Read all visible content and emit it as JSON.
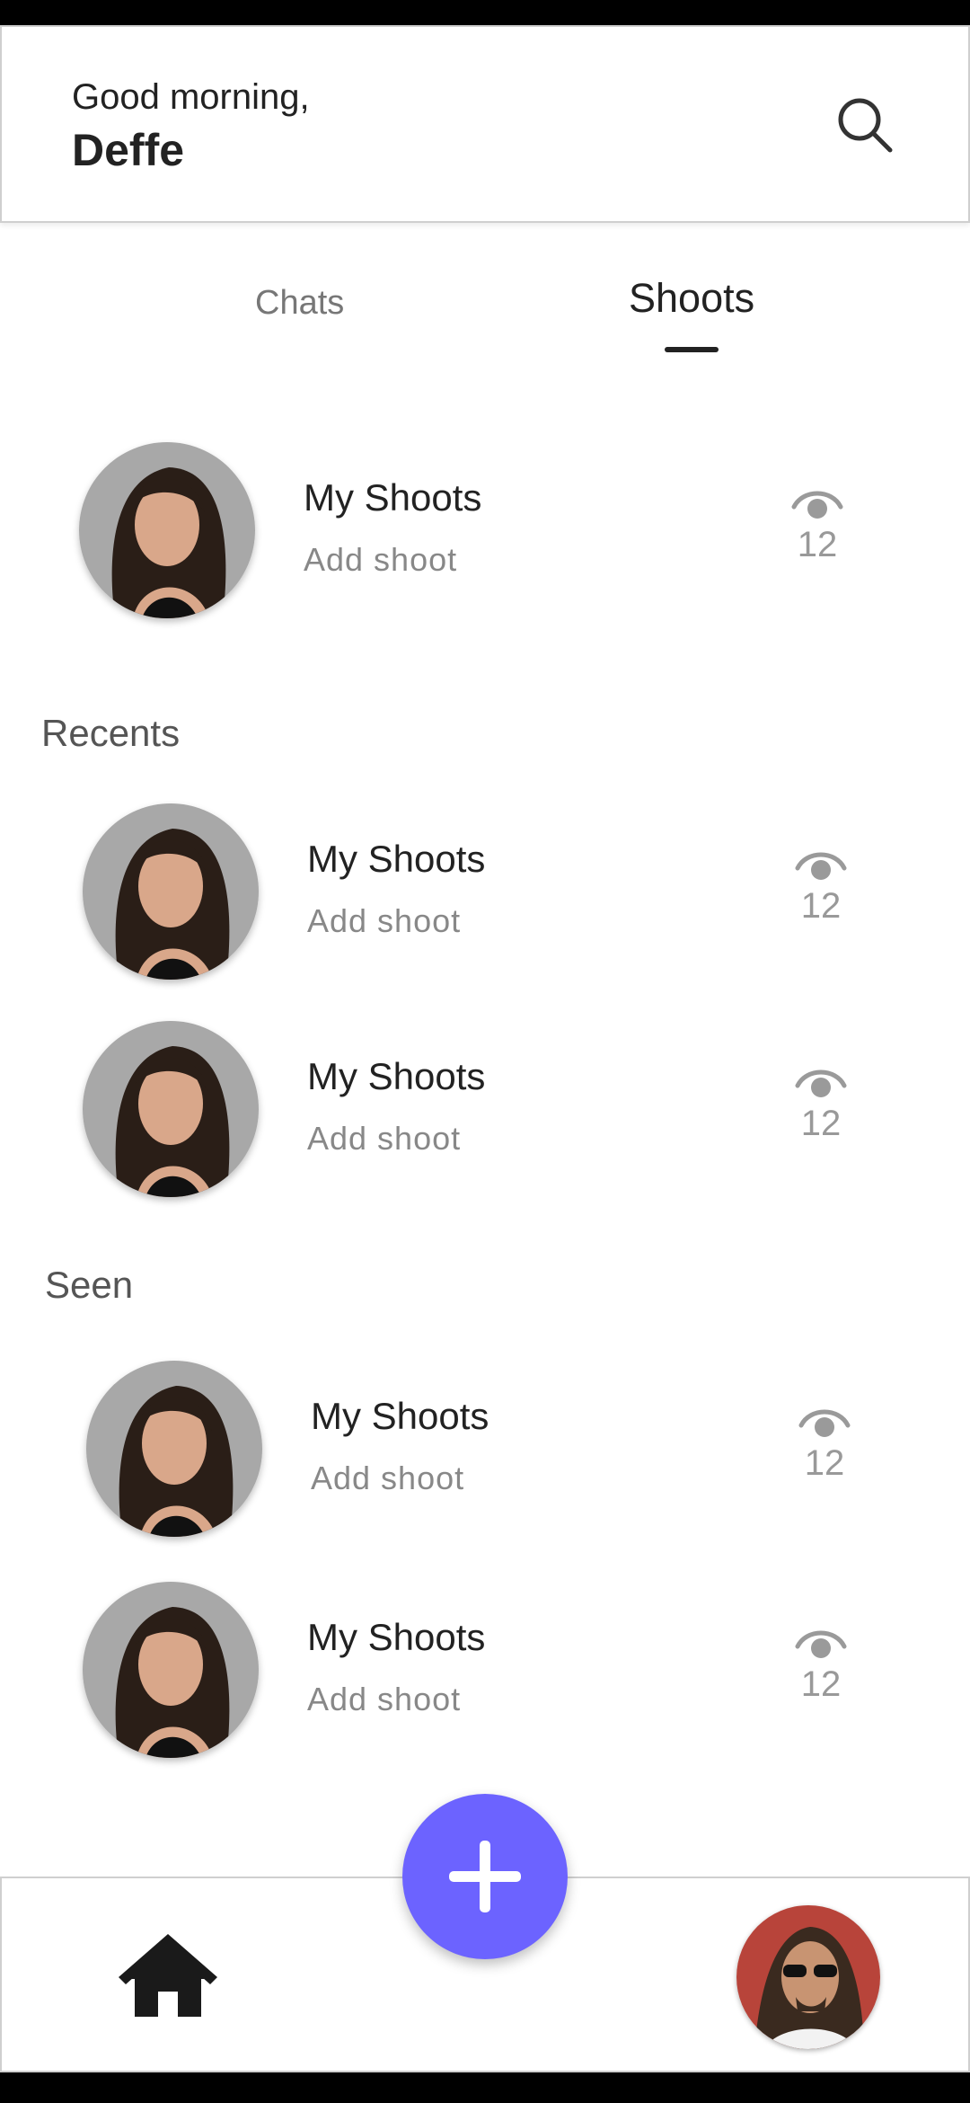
{
  "header": {
    "greeting": "Good morning,",
    "username": "Deffe",
    "search_icon": "search-icon"
  },
  "tabs": [
    {
      "label": "Chats",
      "active": false
    },
    {
      "label": "Shoots",
      "active": true
    }
  ],
  "my_shoot": {
    "title": "My Shoots",
    "subtitle": "Add shoot",
    "views": "12"
  },
  "recents": {
    "title": "Recents",
    "items": [
      {
        "title": "My Shoots",
        "subtitle": "Add shoot",
        "views": "12"
      },
      {
        "title": "My Shoots",
        "subtitle": "Add shoot",
        "views": "12"
      }
    ]
  },
  "seen": {
    "title": "Seen",
    "items": [
      {
        "title": "My Shoots",
        "subtitle": "Add shoot",
        "views": "12"
      },
      {
        "title": "My Shoots",
        "subtitle": "Add shoot",
        "views": "12"
      }
    ]
  },
  "bottom_nav": {
    "home_icon": "home-icon",
    "fab_icon": "plus-icon",
    "profile_icon": "profile-avatar"
  },
  "colors": {
    "accent": "#6c63ff",
    "text_primary": "#222222",
    "text_secondary": "#888888"
  }
}
